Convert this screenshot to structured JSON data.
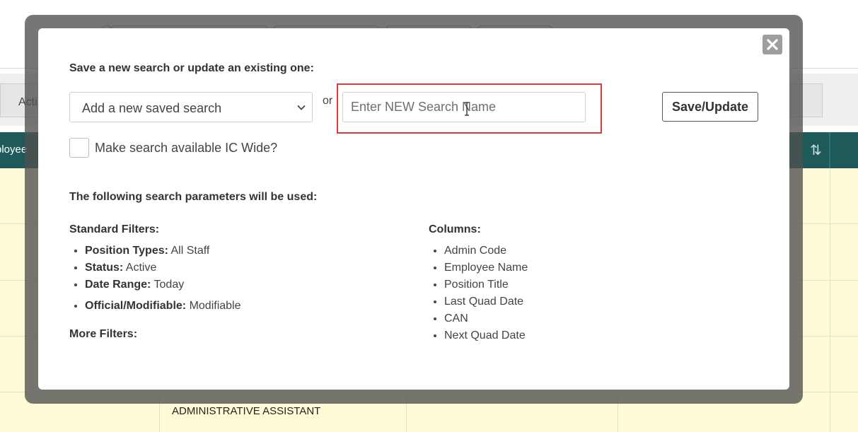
{
  "background": {
    "filter_label": "Acti",
    "table_header_label": "ployee",
    "sort_icon": "sort-arrows-icon",
    "visible_cell": "ADMINISTRATIVE ASSISTANT",
    "header_color": "#1f5a5b",
    "row_color": "#fffbd6"
  },
  "modal": {
    "heading": "Save a new search or update an existing one:",
    "close_icon": "close-icon",
    "select_value": "Add a new saved search",
    "or_label": "or",
    "name_input_placeholder": "Enter NEW Search Name",
    "save_button": "Save/Update",
    "ic_wide_label": "Make search available IC Wide?",
    "params_heading": "The following search parameters will be used:",
    "standard_filters": {
      "title": "Standard Filters:",
      "items": [
        {
          "label": "Position Types:",
          "value": "All Staff"
        },
        {
          "label": "Status:",
          "value": "Active"
        },
        {
          "label": "Date Range:",
          "value": "Today"
        },
        {
          "label": "Official/Modifiable:",
          "value": "Modifiable"
        }
      ]
    },
    "more_filters": {
      "title": "More Filters:"
    },
    "columns": {
      "title": "Columns:",
      "items": [
        "Admin Code",
        "Employee Name",
        "Position Title",
        "Last Quad Date",
        "CAN",
        "Next Quad Date"
      ]
    },
    "highlight_color": "#e03a3a"
  }
}
